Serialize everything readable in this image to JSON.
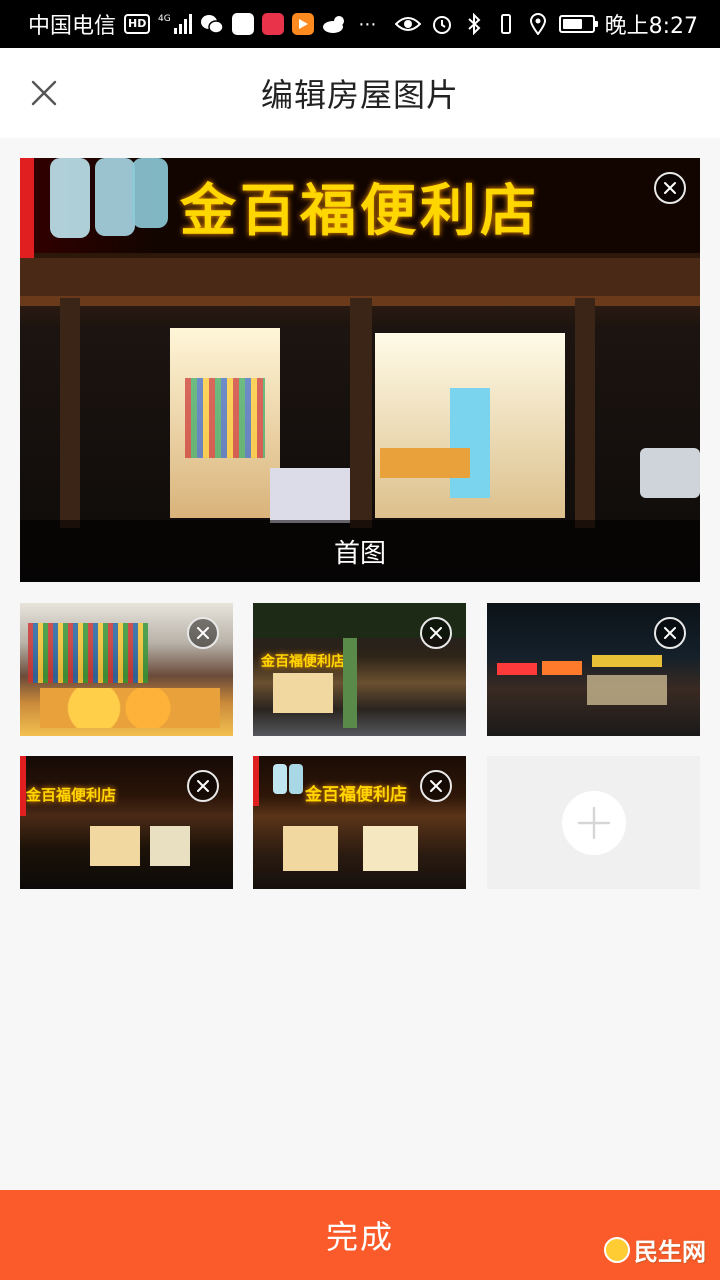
{
  "status_bar": {
    "carrier": "中国电信",
    "hd": "HD",
    "network": "4G",
    "time": "晚上8:27"
  },
  "header": {
    "title": "编辑房屋图片"
  },
  "cover": {
    "caption": "首图",
    "sign_text": "金百福便利店"
  },
  "thumbnails": [
    {
      "sign_text": ""
    },
    {
      "sign_text": "金百福便利店"
    },
    {
      "sign_text": ""
    },
    {
      "sign_text": "金百福便利店"
    },
    {
      "sign_text": "金百福便利店"
    }
  ],
  "footer": {
    "done_label": "完成"
  },
  "watermark": {
    "text": "民生网"
  },
  "colors": {
    "accent": "#fb5a2a",
    "header_bg": "#ffffff",
    "page_bg": "#f7f7f7"
  }
}
